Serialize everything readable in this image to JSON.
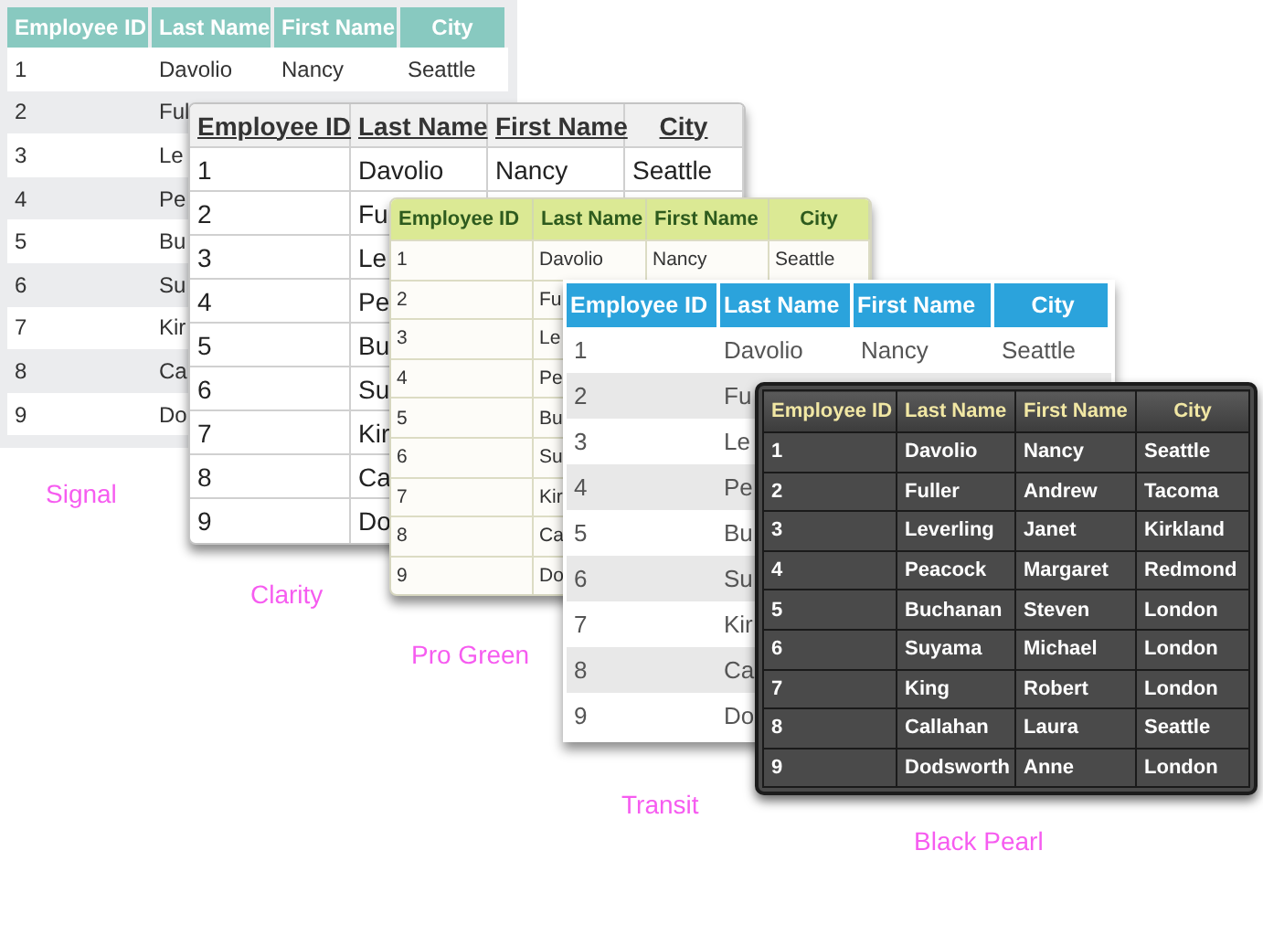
{
  "tables": [
    {
      "kind": "signal",
      "caption": "Signal",
      "columns": [
        "Employee ID",
        "Last Name",
        "First Name",
        "City"
      ],
      "rows": [
        [
          "1",
          "Davolio",
          "Nancy",
          "Seattle"
        ],
        [
          "2",
          "Ful"
        ],
        [
          "3",
          "Le"
        ],
        [
          "4",
          "Pe"
        ],
        [
          "5",
          "Bu"
        ],
        [
          "6",
          "Su"
        ],
        [
          "7",
          "Kir"
        ],
        [
          "8",
          "Ca"
        ],
        [
          "9",
          "Do"
        ]
      ]
    },
    {
      "kind": "clarity",
      "caption": "Clarity",
      "columns": [
        "Employee ID",
        "Last Name",
        "First Name",
        "City"
      ],
      "rows": [
        [
          "1",
          "Davolio",
          "Nancy",
          "Seattle"
        ],
        [
          "2",
          "Fu"
        ],
        [
          "3",
          "Le"
        ],
        [
          "4",
          "Pe"
        ],
        [
          "5",
          "Bu"
        ],
        [
          "6",
          "Su"
        ],
        [
          "7",
          "Kir"
        ],
        [
          "8",
          "Ca"
        ],
        [
          "9",
          "Do"
        ]
      ]
    },
    {
      "kind": "progreen",
      "caption": "Pro Green",
      "columns": [
        "Employee ID",
        "Last Name",
        "First Name",
        "City"
      ],
      "rows": [
        [
          "1",
          "Davolio",
          "Nancy",
          "Seattle"
        ],
        [
          "2",
          "Fu"
        ],
        [
          "3",
          "Le"
        ],
        [
          "4",
          "Pe"
        ],
        [
          "5",
          "Bu"
        ],
        [
          "6",
          "Su"
        ],
        [
          "7",
          "Kir"
        ],
        [
          "8",
          "Ca"
        ],
        [
          "9",
          "Do"
        ]
      ]
    },
    {
      "kind": "transit",
      "caption": "Transit",
      "columns": [
        "Employee ID",
        "Last Name",
        "First Name",
        "City"
      ],
      "rows": [
        [
          "1",
          "Davolio",
          "Nancy",
          "Seattle"
        ],
        [
          "2",
          "Fu"
        ],
        [
          "3",
          "Le"
        ],
        [
          "4",
          "Pe"
        ],
        [
          "5",
          "Bu"
        ],
        [
          "6",
          "Su"
        ],
        [
          "7",
          "Kir"
        ],
        [
          "8",
          "Ca"
        ],
        [
          "9",
          "Do"
        ]
      ]
    },
    {
      "kind": "blackpearl",
      "caption": "Black Pearl",
      "columns": [
        "Employee ID",
        "Last Name",
        "First Name",
        "City"
      ],
      "rows": [
        [
          "1",
          "Davolio",
          "Nancy",
          "Seattle"
        ],
        [
          "2",
          "Fuller",
          "Andrew",
          "Tacoma"
        ],
        [
          "3",
          "Leverling",
          "Janet",
          "Kirkland"
        ],
        [
          "4",
          "Peacock",
          "Margaret",
          "Redmond"
        ],
        [
          "5",
          "Buchanan",
          "Steven",
          "London"
        ],
        [
          "6",
          "Suyama",
          "Michael",
          "London"
        ],
        [
          "7",
          "King",
          "Robert",
          "London"
        ],
        [
          "8",
          "Callahan",
          "Laura",
          "Seattle"
        ],
        [
          "9",
          "Dodsworth",
          "Anne",
          "London"
        ]
      ]
    }
  ]
}
